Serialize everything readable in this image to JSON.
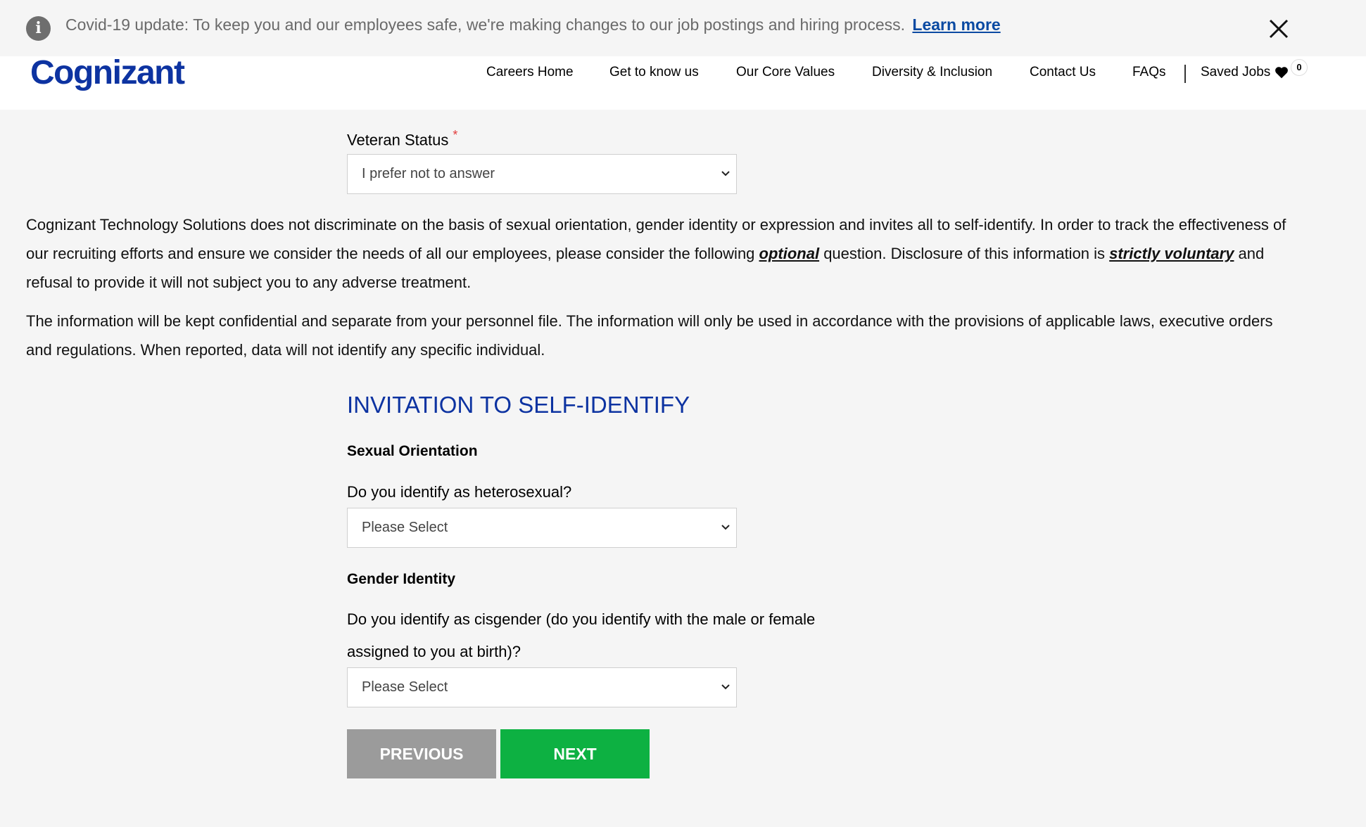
{
  "banner": {
    "info_icon": "info-icon",
    "text": "Covid-19 update: To keep you and our employees safe, we're making changes to our job postings and hiring process.",
    "link": "Learn more",
    "close_icon": "close-icon"
  },
  "header": {
    "logo": "Cognizant",
    "nav": [
      "Careers Home",
      "Get to know us",
      "Our Core Values",
      "Diversity & Inclusion",
      "Contact Us",
      "FAQs"
    ],
    "saved_jobs": "Saved Jobs",
    "saved_count": "0",
    "heart_icon": "heart-icon"
  },
  "form": {
    "veteran_label": "Veteran Status",
    "required_mark": "*",
    "veteran_value": "I prefer not to answer",
    "para1_a": "Cognizant Technology Solutions does not discriminate on the basis of sexual orientation, gender identity or expression and invites all to self-identify. In order to track the effectiveness of our recruiting efforts and ensure we consider the needs of all our employees, please consider the following ",
    "para1_optional": "optional",
    "para1_b": " question. Disclosure of this information is ",
    "para1_voluntary": "strictly voluntary",
    "para1_c": " and refusal to provide it will not subject you to any adverse treatment.",
    "para2": "The information will be kept confidential and separate from your personnel file. The information will only be used in accordance with the provisions of applicable laws, executive orders and regulations. When reported, data will not identify any specific individual.",
    "section_title": "INVITATION TO SELF-IDENTIFY",
    "orientation_head": "Sexual Orientation",
    "orientation_q": "Do you identify as heterosexual?",
    "orientation_value": "Please Select",
    "gender_head": "Gender Identity",
    "gender_q": "Do you identify as cisgender (do you identify with the male or female assigned to you at birth)?",
    "gender_value": "Please Select",
    "prev_label": "PREVIOUS",
    "next_label": "NEXT"
  },
  "colors": {
    "brand": "#0d33a1",
    "next": "#0db142",
    "prev": "#9b9b9b",
    "required": "#e23d3d"
  }
}
